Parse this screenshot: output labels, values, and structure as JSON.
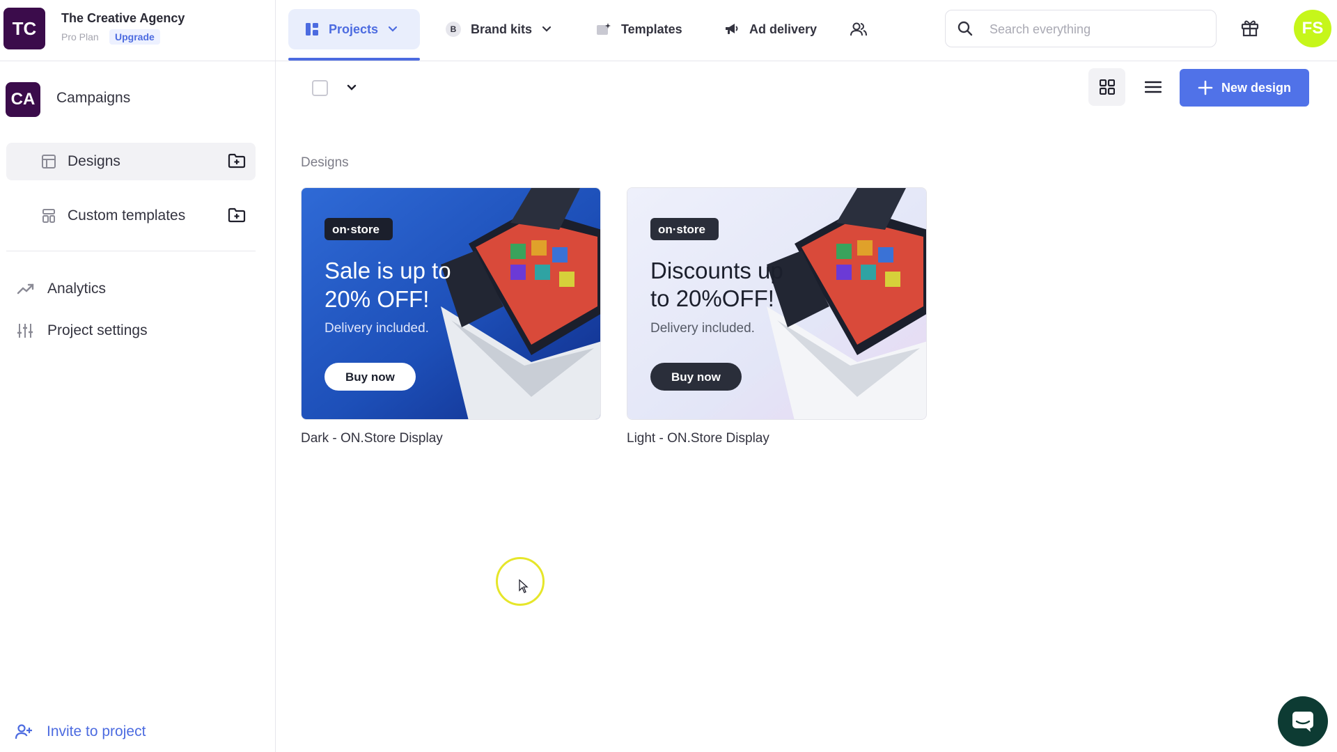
{
  "org": {
    "initials": "TC",
    "name": "The Creative Agency",
    "plan": "Pro Plan",
    "upgrade_label": "Upgrade"
  },
  "nav": {
    "projects": "Projects",
    "brand_kits_badge": "B",
    "brand_kits": "Brand kits",
    "templates": "Templates",
    "ad_delivery": "Ad delivery"
  },
  "search": {
    "placeholder": "Search everything",
    "value": ""
  },
  "user": {
    "initials": "FS"
  },
  "sidebar": {
    "project_initials": "CA",
    "project_name": "Campaigns",
    "items": [
      {
        "label": "Designs",
        "active": true
      },
      {
        "label": "Custom templates",
        "active": false
      }
    ],
    "links": [
      {
        "label": "Analytics"
      },
      {
        "label": "Project settings"
      }
    ],
    "invite": "Invite to project"
  },
  "main": {
    "new_design_label": "New design",
    "section_title": "Designs",
    "designs": [
      {
        "name": "Dark - ON.Store Display",
        "variant": "dark",
        "brand": "on·store",
        "headline_1": "Sale is up to",
        "headline_2": "20% OFF!",
        "subline": "Delivery included.",
        "cta": "Buy now"
      },
      {
        "name": "Light - ON.Store Display",
        "variant": "light",
        "brand": "on·store",
        "headline_1": "Discounts up",
        "headline_2": "to 20%OFF!",
        "subline": "Delivery included.",
        "cta": "Buy now"
      }
    ]
  },
  "colors": {
    "accent": "#5072e8",
    "org_avatar": "#3b0c4b",
    "user_avatar": "#c6f61a",
    "chat": "#0d3b33"
  }
}
